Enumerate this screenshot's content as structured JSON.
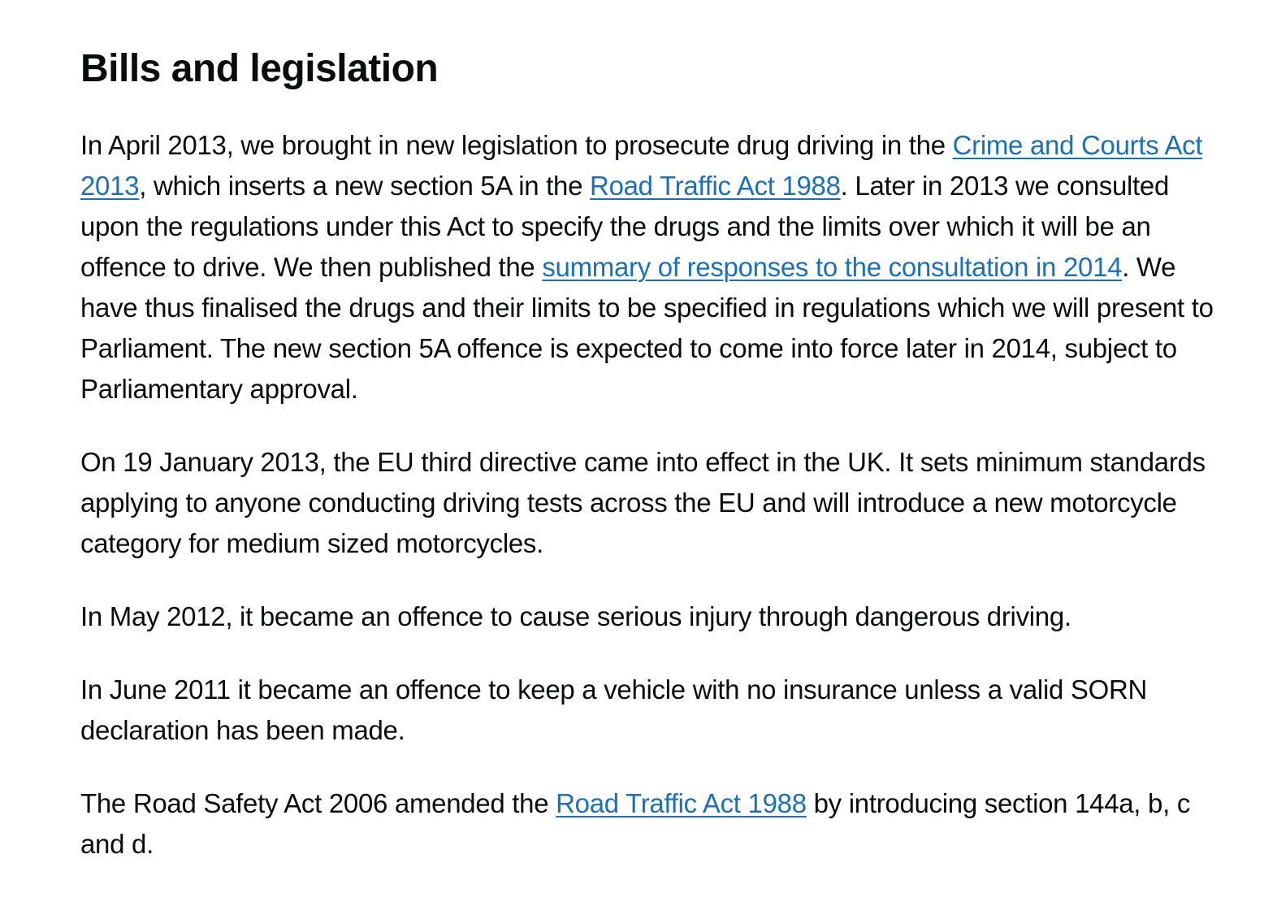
{
  "heading": "Bills and legislation",
  "paragraphs": {
    "p1": {
      "t1": "In April 2013, we brought in new legislation to prosecute drug driving in the ",
      "link1": "Crime and Courts Act 2013",
      "t2": ", which inserts a new section 5A in the ",
      "link2": "Road Traffic Act 1988",
      "t3": ". Later in 2013 we consulted upon the regulations under this Act to specify the drugs and the limits over which it will be an offence to drive. We then published the ",
      "link3": "summary of responses to the consultation in 2014",
      "t4": ". We have thus finalised the drugs and their limits to be specified in regulations which we will present to Parliament. The new section 5A offence is expected to come into force later in 2014, subject to Parliamentary approval."
    },
    "p2": "On 19 January 2013, the EU third directive came into effect in the UK. It sets minimum standards applying to anyone conducting driving tests across the EU and will introduce a new motorcycle category for medium sized motorcycles.",
    "p3": "In May 2012, it became an offence to cause serious injury through dangerous driving.",
    "p4": "In June 2011 it became an offence to keep a vehicle with no insurance unless a valid SORN declaration has been made.",
    "p5": {
      "t1": "The Road Safety Act 2006 amended the ",
      "link1": "Road Traffic Act 1988",
      "t2": " by introducing section 144a, b, c and d."
    }
  },
  "colors": {
    "text": "#0b0c0c",
    "link": "#1d70b8",
    "background": "#ffffff"
  }
}
